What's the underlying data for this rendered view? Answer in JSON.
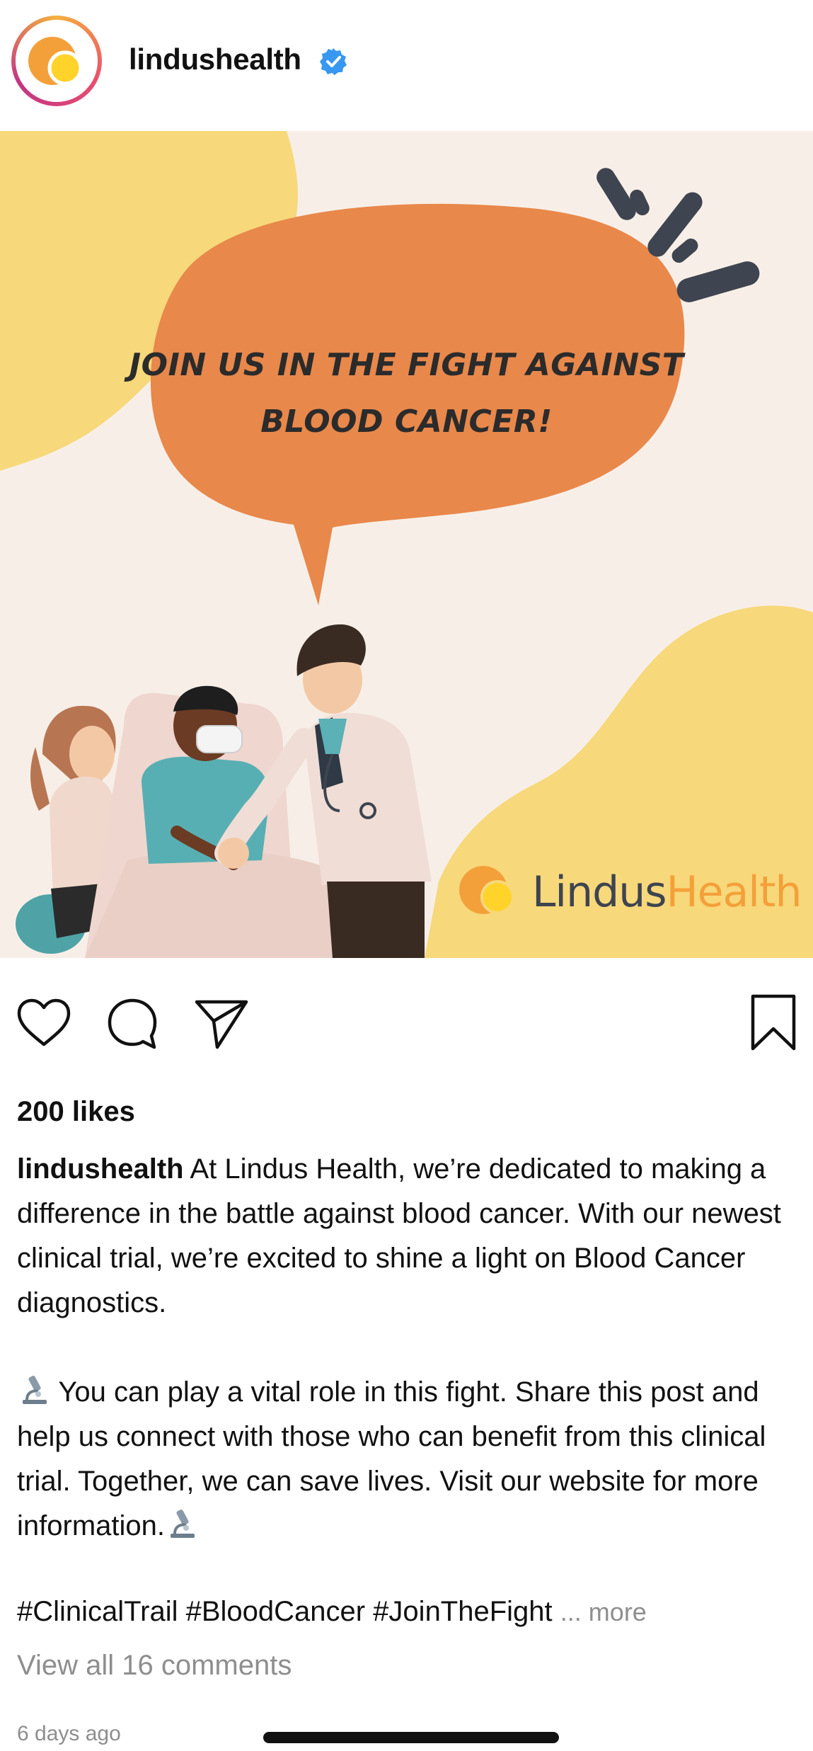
{
  "header": {
    "username": "lindushealth",
    "avatar_icon": "lindus-logo-icon",
    "verified_icon": "verified-badge-icon"
  },
  "post_image": {
    "headline_line1": "JOIN US IN THE FIGHT AGAINST",
    "headline_line2": "BLOOD CANCER!",
    "brand_part1": "Lindus",
    "brand_part2": "Health",
    "colors": {
      "orange": "#E8884B",
      "yellow": "#F7D87A",
      "cream": "#F7EFE7",
      "dark": "#3E4450",
      "brand_orange": "#F4A03A"
    }
  },
  "actions": {
    "like_icon": "heart-icon",
    "comment_icon": "comment-icon",
    "share_icon": "send-icon",
    "save_icon": "bookmark-icon"
  },
  "likes": "200 likes",
  "caption": {
    "username": "lindushealth",
    "para1": "At Lindus Health, we’re dedicated to making a difference in the battle against blood cancer. With our newest clinical trial, we’re excited to shine a light on Blood Cancer diagnostics.",
    "para2": "You can play a vital role in this fight. Share this post and help us connect with those who can benefit from this clinical trial. Together, we can save lives. Visit our website for more information.",
    "emoji_icon": "microscope-icon",
    "hashtags": "#ClinicalTrail #BloodCancer #JoinTheFight",
    "more_label": "... more"
  },
  "view_comments": "View all 16 comments",
  "time_ago": "6 days ago"
}
